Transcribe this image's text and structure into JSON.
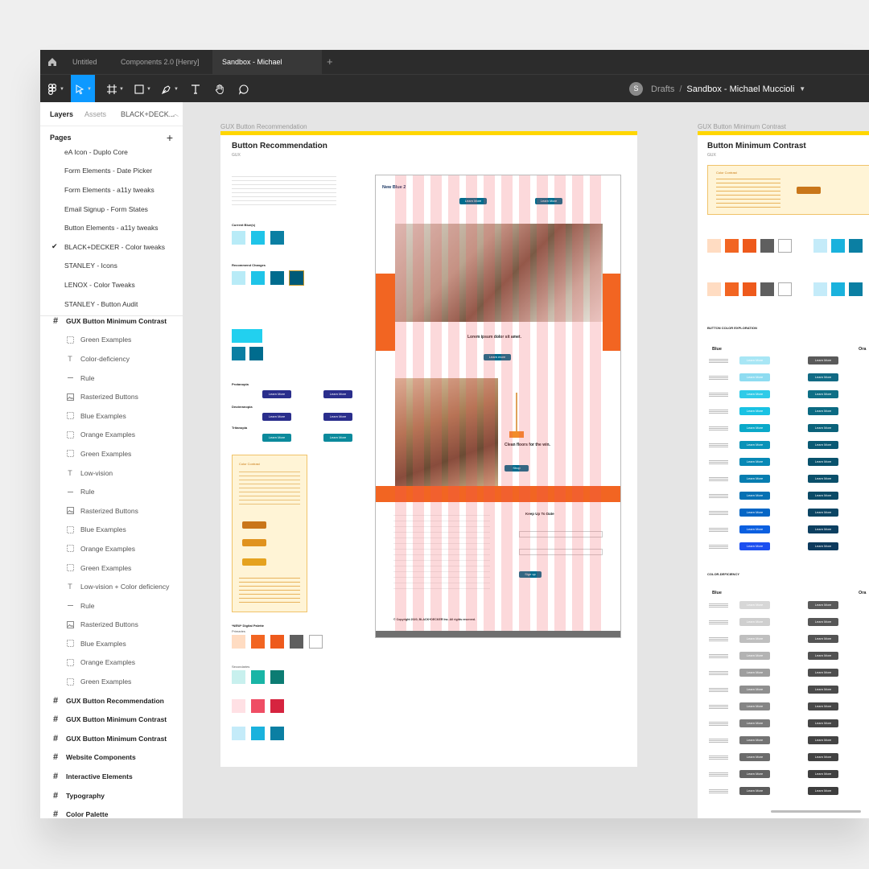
{
  "tabs": {
    "items": [
      {
        "label": "Untitled"
      },
      {
        "label": "Components 2.0 [Henry]"
      },
      {
        "label": "Sandbox - Michael Muccioli"
      }
    ],
    "close": "×",
    "add": "+"
  },
  "toolbar": {
    "breadcrumb": {
      "avatar": "S",
      "folder": "Drafts",
      "separator": "/",
      "file": "Sandbox - Michael Muccioli"
    }
  },
  "sidebar": {
    "tabs": {
      "layers": "Layers",
      "assets": "Assets",
      "page": "BLACK+DECK..."
    },
    "pages_label": "Pages",
    "pages_add": "+",
    "pages": [
      {
        "label": "eA Icon - Duplo Core",
        "current": false
      },
      {
        "label": "Form Elements - Date Picker",
        "current": false
      },
      {
        "label": "Form Elements - a11y tweaks",
        "current": false
      },
      {
        "label": "Email Signup - Form States",
        "current": false
      },
      {
        "label": "Button Elements - a11y tweaks",
        "current": false
      },
      {
        "label": "BLACK+DECKER - Color tweaks",
        "current": true
      },
      {
        "label": "STANLEY - Icons",
        "current": false
      },
      {
        "label": "LENOX - Color Tweaks",
        "current": false
      },
      {
        "label": "STANLEY - Button Audit",
        "current": false
      }
    ],
    "check": "✔",
    "layers": [
      {
        "type": "frame",
        "icon": "#",
        "label": "GUX Button Minimum Contrast"
      },
      {
        "type": "child",
        "icon": "dash-frame",
        "label": "Green Examples"
      },
      {
        "type": "child",
        "icon": "T",
        "label": "Color-deficiency"
      },
      {
        "type": "child",
        "icon": "line",
        "label": "Rule"
      },
      {
        "type": "child",
        "icon": "image",
        "label": "Rasterized Buttons"
      },
      {
        "type": "child",
        "icon": "dash-frame",
        "label": "Blue Examples"
      },
      {
        "type": "child",
        "icon": "dash-frame",
        "label": "Orange Examples"
      },
      {
        "type": "child",
        "icon": "dash-frame",
        "label": "Green Examples"
      },
      {
        "type": "child",
        "icon": "T",
        "label": "Low-vision"
      },
      {
        "type": "child",
        "icon": "line",
        "label": "Rule"
      },
      {
        "type": "child",
        "icon": "image",
        "label": "Rasterized Buttons"
      },
      {
        "type": "child",
        "icon": "dash-frame",
        "label": "Blue Examples"
      },
      {
        "type": "child",
        "icon": "dash-frame",
        "label": "Orange Examples"
      },
      {
        "type": "child",
        "icon": "dash-frame",
        "label": "Green Examples"
      },
      {
        "type": "child",
        "icon": "T",
        "label": "Low-vision + Color deficiency"
      },
      {
        "type": "child",
        "icon": "line",
        "label": "Rule"
      },
      {
        "type": "child",
        "icon": "image",
        "label": "Rasterized Buttons"
      },
      {
        "type": "child",
        "icon": "dash-frame",
        "label": "Blue Examples"
      },
      {
        "type": "child",
        "icon": "dash-frame",
        "label": "Orange Examples"
      },
      {
        "type": "child",
        "icon": "dash-frame",
        "label": "Green Examples"
      },
      {
        "type": "frame",
        "icon": "#",
        "label": "GUX Button Recommendation"
      },
      {
        "type": "frame",
        "icon": "#",
        "label": "GUX Button Minimum Contrast"
      },
      {
        "type": "frame",
        "icon": "#",
        "label": "GUX Button Minimum Contrast"
      },
      {
        "type": "frame",
        "icon": "#",
        "label": "Website Components"
      },
      {
        "type": "frame",
        "icon": "#",
        "label": "Interactive Elements"
      },
      {
        "type": "frame",
        "icon": "#",
        "label": "Typography"
      },
      {
        "type": "frame",
        "icon": "#",
        "label": "Color Palette"
      }
    ]
  },
  "canvas": {
    "frame1": {
      "label": "GUX Button Recommendation",
      "title": "Button Recommendation",
      "subtitle": "GUX",
      "current_blue": "Current Blue(s)",
      "recommend_changes": "Recommend Changes",
      "protanopia": "Protanopia",
      "deuteranopia": "Deuteranopia",
      "tritanopia": "Tritanopia",
      "learn_more": "Learn More",
      "color_contrast": "Color Contrast",
      "digital_palette": "*NEW* Digital Palette",
      "primaries": "Primaries",
      "secondaries": "Secondaries",
      "site_title": "New Blue 2",
      "hero_heading": "Lorem ipsum dolor sit amet.",
      "hero_button": "Learn more",
      "clean_heading": "Clean floors for the win.",
      "clean_button": "Shop",
      "footer_signup": "Keep Up To Date",
      "footer_button": "Sign up",
      "copyright": "© Copyright 2020, BLACK+DECKER Inc. All rights reserved."
    },
    "frame2": {
      "label": "GUX Button Minimum Contrast",
      "title": "Button Minimum Contrast",
      "subtitle": "GUX",
      "color_contrast": "Color Contrast",
      "exploration": "BUTTON COLOR EXPLORATION",
      "deficiency": "COLOR-DEFICIENCY",
      "blue": "Blue",
      "orange": "Ora",
      "learn_more": "Learn More"
    }
  },
  "colors": {
    "accent": "#0d99ff",
    "chrome": "#2c2c2c",
    "frame_bar": "#ffd600",
    "orange": "#f26522",
    "teal": "#006c8e",
    "navy": "#2a2e8c"
  }
}
